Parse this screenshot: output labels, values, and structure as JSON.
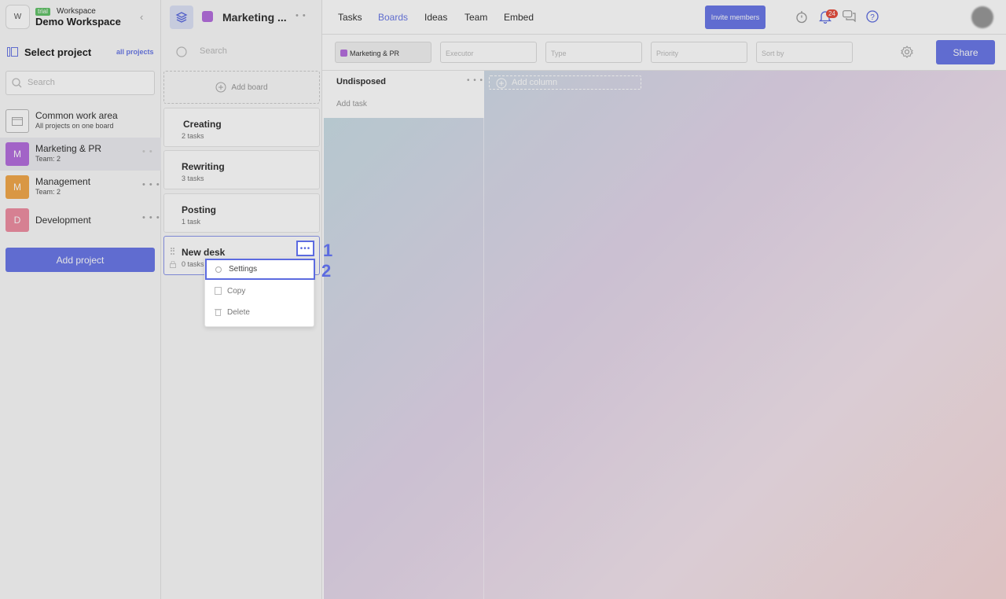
{
  "workspace": {
    "logo_letter": "W",
    "trial_badge": "trial",
    "label": "Workspace",
    "name": "Demo Workspace"
  },
  "sidebar": {
    "title": "Select project",
    "all_projects_link": "all projects",
    "search_placeholder": "Search",
    "projects": [
      {
        "name": "Common work area",
        "sub": "All projects on one board",
        "letter": "",
        "color": "#ffffff"
      },
      {
        "name": "Marketing & PR",
        "sub": "Team: 2",
        "letter": "M",
        "color": "#b56fde"
      },
      {
        "name": "Management",
        "sub": "Team: 2",
        "letter": "M",
        "color": "#f2a94c"
      },
      {
        "name": "Development",
        "sub": "",
        "letter": "D",
        "color": "#ef8fa3"
      }
    ],
    "add_project": "Add project"
  },
  "boards_panel": {
    "project_title": "Marketing ...",
    "search_placeholder": "Search",
    "add_board": "Add board",
    "boards": [
      {
        "title": "Creating",
        "count": "2 tasks"
      },
      {
        "title": "Rewriting",
        "count": "3 tasks"
      },
      {
        "title": "Posting",
        "count": "1 task"
      },
      {
        "title": "New desk",
        "count": "0 tasks"
      }
    ]
  },
  "context_menu": {
    "items": [
      "Settings",
      "Copy",
      "Delete"
    ]
  },
  "steps": {
    "one": "1",
    "two": "2"
  },
  "nav": {
    "tabs": [
      "Tasks",
      "Boards",
      "Ideas",
      "Team",
      "Embed"
    ],
    "active_tab": "Boards",
    "invite": "Invite members",
    "notif_count": "24"
  },
  "filters": {
    "project": "Marketing & PR",
    "executor": "Executor",
    "type": "Type",
    "priority": "Priority",
    "sort": "Sort by",
    "share": "Share"
  },
  "board": {
    "columns": [
      {
        "title": "Undisposed",
        "add_task": "Add task"
      }
    ],
    "add_column": "Add column"
  },
  "colors": {
    "accent": "#6b79e8",
    "highlight": "#5c6be0"
  }
}
